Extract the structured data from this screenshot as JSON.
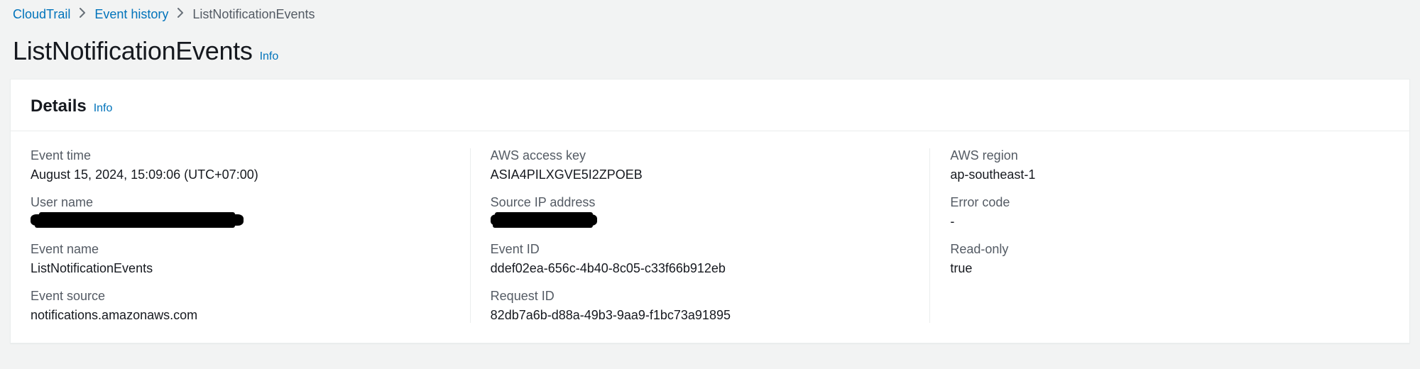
{
  "breadcrumb": {
    "root": "CloudTrail",
    "parent": "Event history",
    "current": "ListNotificationEvents"
  },
  "page": {
    "title": "ListNotificationEvents",
    "info": "Info"
  },
  "details": {
    "title": "Details",
    "info": "Info",
    "fields": {
      "event_time": {
        "label": "Event time",
        "value": "August 15, 2024, 15:09:06 (UTC+07:00)"
      },
      "user_name": {
        "label": "User name",
        "value": ""
      },
      "event_name": {
        "label": "Event name",
        "value": "ListNotificationEvents"
      },
      "event_source": {
        "label": "Event source",
        "value": "notifications.amazonaws.com"
      },
      "aws_access_key": {
        "label": "AWS access key",
        "value": "ASIA4PILXGVE5I2ZPOEB"
      },
      "source_ip_address": {
        "label": "Source IP address",
        "value": ""
      },
      "event_id": {
        "label": "Event ID",
        "value": "ddef02ea-656c-4b40-8c05-c33f66b912eb"
      },
      "request_id": {
        "label": "Request ID",
        "value": "82db7a6b-d88a-49b3-9aa9-f1bc73a91895"
      },
      "aws_region": {
        "label": "AWS region",
        "value": "ap-southeast-1"
      },
      "error_code": {
        "label": "Error code",
        "value": "-"
      },
      "read_only": {
        "label": "Read-only",
        "value": "true"
      }
    }
  }
}
